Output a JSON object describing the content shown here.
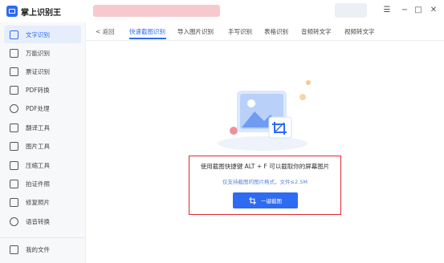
{
  "app": {
    "title": "掌上识别王"
  },
  "window_controls": {
    "menu": "☰",
    "minimize": "−",
    "maximize": "□",
    "close": "✕"
  },
  "sidebar": {
    "items": [
      {
        "label": "文字识别",
        "icon": "text-recognition-icon",
        "active": true
      },
      {
        "label": "万能识别",
        "icon": "camera-icon"
      },
      {
        "label": "票证识别",
        "icon": "ticket-icon"
      },
      {
        "label": "PDF转换",
        "icon": "pdf-convert-icon"
      },
      {
        "label": "PDF处理",
        "icon": "pdf-process-icon"
      },
      {
        "label": "翻译工具",
        "icon": "translate-icon"
      },
      {
        "label": "图片工具",
        "icon": "image-tool-icon"
      },
      {
        "label": "压缩工具",
        "icon": "compress-icon"
      },
      {
        "label": "拍证件照",
        "icon": "id-photo-icon"
      },
      {
        "label": "修复照片",
        "icon": "repair-photo-icon"
      },
      {
        "label": "语音转换",
        "icon": "audio-convert-icon"
      }
    ],
    "my_files": {
      "label": "我的文件",
      "icon": "folder-icon"
    }
  },
  "tabs": {
    "back_label": "< 返回",
    "items": [
      {
        "label": "快速截图识别",
        "active": true
      },
      {
        "label": "导入图片识别"
      },
      {
        "label": "手写识别"
      },
      {
        "label": "表格识别"
      },
      {
        "label": "音频转文字"
      },
      {
        "label": "视频转文字"
      }
    ]
  },
  "main": {
    "hint": "使用截图快捷键 ALT + F 可以截取你的屏幕图片",
    "sub_hint": "仅支持截图的图片格式，文件≤2.5M",
    "button_label": "一键截图"
  },
  "colors": {
    "accent": "#2f6bf2",
    "highlight": "#e0262e"
  }
}
